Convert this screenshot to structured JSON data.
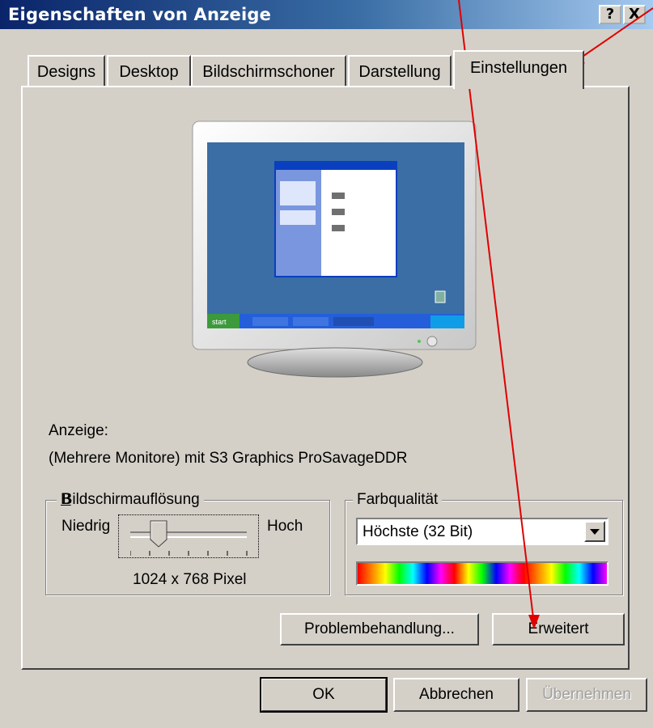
{
  "window": {
    "title": "Eigenschaften von Anzeige",
    "help_label": "?",
    "close_label": "X"
  },
  "tabs": [
    {
      "label": "Designs"
    },
    {
      "label": "Desktop"
    },
    {
      "label": "Bildschirmschoner"
    },
    {
      "label": "Darstellung"
    },
    {
      "label": "Einstellungen",
      "active": true
    }
  ],
  "display": {
    "label": "Anzeige:",
    "value": "(Mehrere Monitore) mit S3 Graphics ProSavageDDR"
  },
  "resolution": {
    "group_label": "Bildschirmauflösung",
    "low": "Niedrig",
    "high": "Hoch",
    "value": "1024 x 768 Pixel"
  },
  "color": {
    "group_label": "Farbqualität",
    "selected": "Höchste (32 Bit)"
  },
  "buttons": {
    "troubleshoot": "Problembehandlung...",
    "advanced": "Erweitert",
    "ok": "OK",
    "cancel": "Abbrechen",
    "apply": "Übernehmen"
  },
  "preview": {
    "start_label": "start"
  },
  "colors": {
    "annotation_arrow": "#e00000",
    "title_start": "#0a246a",
    "desktop": "#3a6ea5"
  }
}
